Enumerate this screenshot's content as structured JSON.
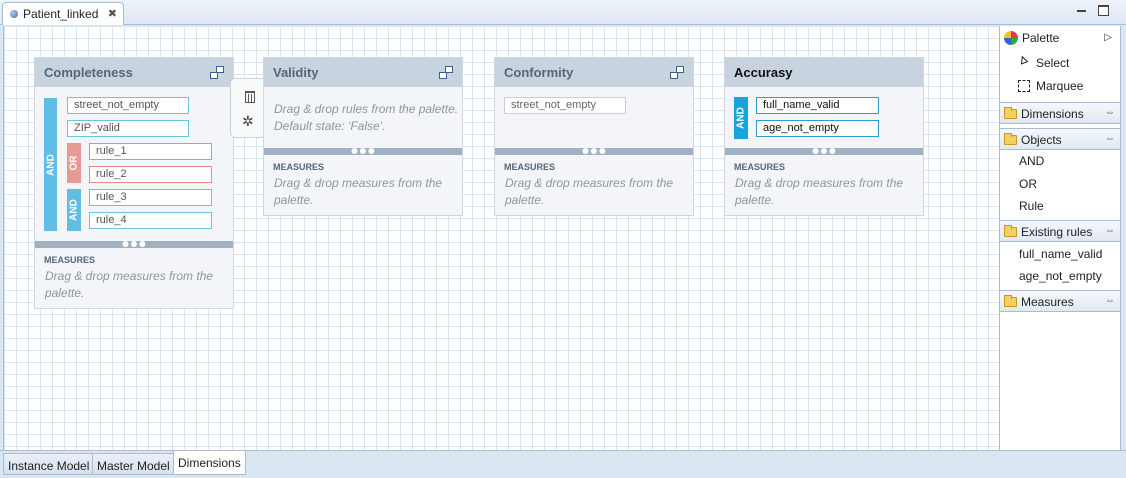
{
  "editor": {
    "tab_title": "Patient_linked",
    "close_glyph": "✖"
  },
  "dimensions": [
    {
      "name": "Completeness",
      "rules_ungrouped": [
        "street_not_empty",
        "ZIP_valid"
      ],
      "operator_outer": "AND",
      "operator_or": "OR",
      "or_rules": [
        "rule_1",
        "rule_2"
      ],
      "operator_and": "AND",
      "and_rules": [
        "rule_3",
        "rule_4"
      ],
      "measures_label": "MEASURES",
      "measures_hint": "Drag & drop measures from the palette."
    },
    {
      "name": "Validity",
      "rules_hint": "Drag & drop rules from the palette. Default state: 'False'.",
      "measures_label": "MEASURES",
      "measures_hint": "Drag & drop measures from the palette."
    },
    {
      "name": "Conformity",
      "rules": [
        "street_not_empty"
      ],
      "measures_label": "MEASURES",
      "measures_hint": "Drag & drop measures from the palette."
    },
    {
      "name": "Accurasy",
      "operator": "AND",
      "rules": [
        "full_name_valid",
        "age_not_empty"
      ],
      "measures_label": "MEASURES",
      "measures_hint": "Drag & drop measures from the palette."
    }
  ],
  "divider_dots": "●●●",
  "palette": {
    "title": "Palette",
    "tools": [
      "Select",
      "Marquee"
    ],
    "drawers": {
      "dimensions": "Dimensions",
      "objects": "Objects",
      "existing_rules": "Existing rules",
      "measures": "Measures"
    },
    "objects": [
      "AND",
      "OR",
      "Rule"
    ],
    "existing_rules": [
      "full_name_valid",
      "age_not_empty"
    ],
    "pin_glyph": "⇔"
  },
  "bottom_tabs": [
    "Instance Model",
    "Master Model",
    "Dimensions"
  ],
  "selected_bottom_tab": "Dimensions"
}
